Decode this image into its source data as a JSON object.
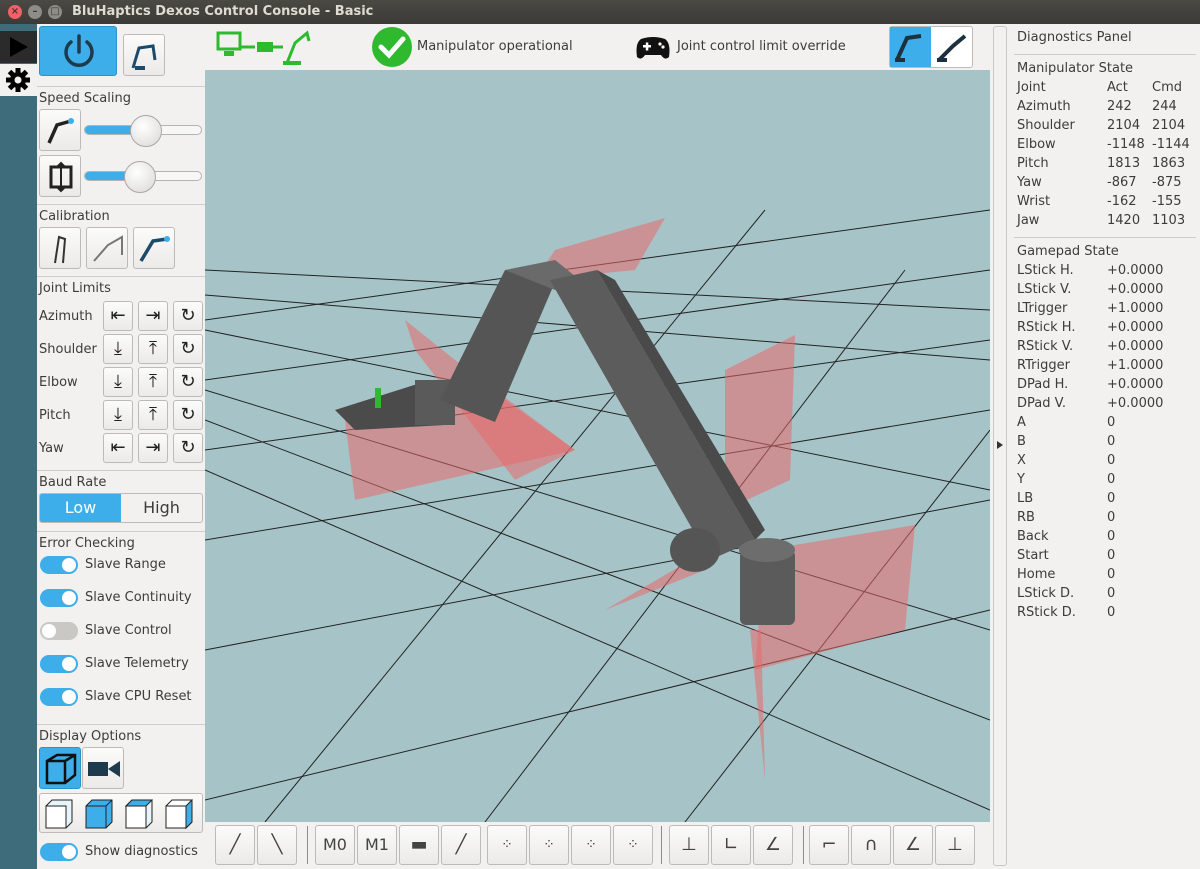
{
  "window": {
    "title": "BluHaptics Dexos Control Console - Basic"
  },
  "status": {
    "manipulator": "Manipulator operational",
    "override": "Joint control limit override"
  },
  "sidebar": {
    "speed_scaling": "Speed Scaling",
    "speed_sliders": [
      0.52,
      0.47
    ],
    "calibration": "Calibration",
    "joint_limits": "Joint Limits",
    "joints": [
      "Azimuth",
      "Shoulder",
      "Elbow",
      "Pitch",
      "Yaw"
    ],
    "baud_rate": "Baud Rate",
    "baud": {
      "low": "Low",
      "high": "High",
      "selected": "Low"
    },
    "error_checking": "Error Checking",
    "checks": [
      {
        "label": "Slave Range",
        "on": true
      },
      {
        "label": "Slave Continuity",
        "on": true
      },
      {
        "label": "Slave Control",
        "on": false
      },
      {
        "label": "Slave Telemetry",
        "on": true
      },
      {
        "label": "Slave CPU Reset",
        "on": true
      }
    ],
    "display_options": "Display Options",
    "show_diagnostics": {
      "label": "Show diagnostics",
      "on": true
    }
  },
  "bottom": {
    "m0": "M0",
    "m1": "M1"
  },
  "diagnostics": {
    "title": "Diagnostics Panel",
    "manip_title": "Manipulator State",
    "manip_header": [
      "Joint",
      "Act",
      "Cmd"
    ],
    "manip_rows": [
      [
        "Azimuth",
        "242",
        "244"
      ],
      [
        "Shoulder",
        "2104",
        "2104"
      ],
      [
        "Elbow",
        "-1148",
        "-1144"
      ],
      [
        "Pitch",
        "1813",
        "1863"
      ],
      [
        "Yaw",
        "-867",
        "-875"
      ],
      [
        "Wrist",
        "-162",
        "-155"
      ],
      [
        "Jaw",
        "1420",
        "1103"
      ]
    ],
    "gamepad_title": "Gamepad State",
    "gamepad_rows": [
      [
        "LStick H.",
        "+0.0000"
      ],
      [
        "LStick V.",
        "+0.0000"
      ],
      [
        "LTrigger",
        "+1.0000"
      ],
      [
        "RStick H.",
        "+0.0000"
      ],
      [
        "RStick V.",
        "+0.0000"
      ],
      [
        "RTrigger",
        "+1.0000"
      ],
      [
        "DPad H.",
        "+0.0000"
      ],
      [
        "DPad V.",
        "+0.0000"
      ],
      [
        "A",
        "0"
      ],
      [
        "B",
        "0"
      ],
      [
        "X",
        "0"
      ],
      [
        "Y",
        "0"
      ],
      [
        "LB",
        "0"
      ],
      [
        "RB",
        "0"
      ],
      [
        "Back",
        "0"
      ],
      [
        "Start",
        "0"
      ],
      [
        "Home",
        "0"
      ],
      [
        "LStick D.",
        "0"
      ],
      [
        "RStick D.",
        "0"
      ]
    ]
  },
  "colors": {
    "accent": "#3daee9",
    "ok_green": "#2fb92f",
    "link_green": "#42c442",
    "viewport_bg": "#a6c4c7",
    "arm": "#5a5a5a",
    "limit_plane": "#e86a6a"
  }
}
